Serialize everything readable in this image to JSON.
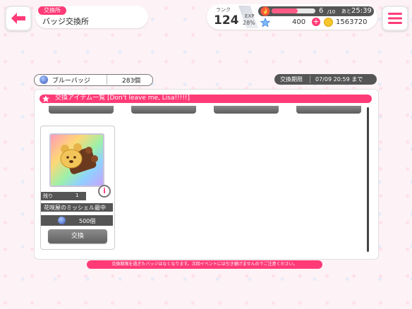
{
  "header": {
    "category": "交換所",
    "title": "バッジ交換所",
    "back_icon": "back-arrow-icon",
    "menu_icon": "hamburger-menu-icon"
  },
  "status": {
    "rank_label": "ランク",
    "rank": "124",
    "exp_label": "EXP",
    "exp_percent": "28%",
    "energy_current": "6",
    "energy_max": "/10",
    "energy_fill_fraction": 0.6,
    "timer_label": "あと",
    "timer": "25:39",
    "stars": "400",
    "coins": "1563720",
    "plus": "+"
  },
  "badge": {
    "name": "ブルーバッジ",
    "count": "283個"
  },
  "period": {
    "label": "交換期限",
    "value": "07/09 20:59 まで"
  },
  "panel": {
    "title": "交換アイテム一覧 [Don't leave me, Lisa!!!!!]"
  },
  "item": {
    "remaining_label": "残り",
    "remaining_count": "1",
    "name": "花咲屋のミッシェル最中",
    "cost": "500個",
    "exchange_label": "交換",
    "info_label": "i"
  },
  "notice": "交換期限を過ぎたバッジはなくなります。次回イベントには引き継げませんのでご注意ください。",
  "colors": {
    "accent": "#ff3b77",
    "dark_bar": "#555555",
    "button_gray": "#6e6e6e"
  }
}
